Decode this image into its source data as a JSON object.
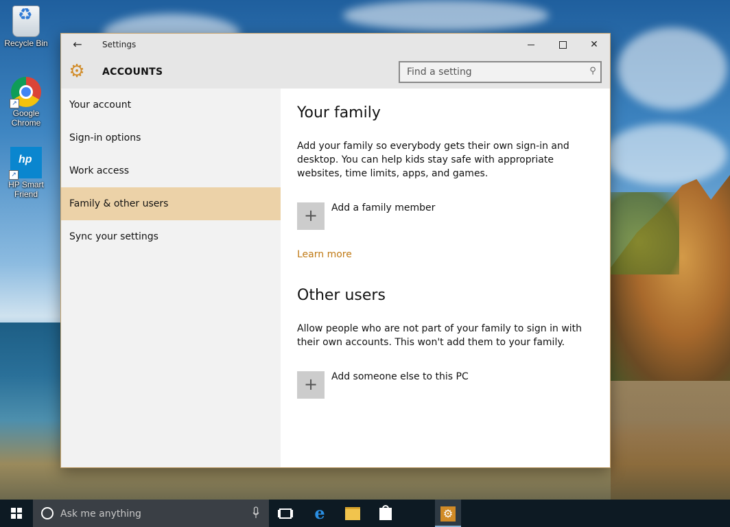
{
  "desktop": {
    "icons": [
      {
        "label": "Recycle Bin"
      },
      {
        "label": "Google Chrome"
      },
      {
        "label": "HP Smart Friend"
      }
    ]
  },
  "window": {
    "title": "Settings",
    "back_glyph": "←",
    "close_glyph": "✕"
  },
  "header": {
    "section_title": "ACCOUNTS",
    "gear_glyph": "⚙",
    "search_placeholder": "Find a setting",
    "search_glyph": "⚲"
  },
  "sidebar": {
    "items": [
      {
        "label": "Your account",
        "active": false
      },
      {
        "label": "Sign-in options",
        "active": false
      },
      {
        "label": "Work access",
        "active": false
      },
      {
        "label": "Family & other users",
        "active": true
      },
      {
        "label": "Sync your settings",
        "active": false
      }
    ]
  },
  "content": {
    "family": {
      "heading": "Your family",
      "description": "Add your family so everybody gets their own sign-in and desktop. You can help kids stay safe with appropriate websites, time limits, apps, and games.",
      "add_label": "Add a family member",
      "learn_more": "Learn more"
    },
    "other_users": {
      "heading": "Other users",
      "description": "Allow people who are not part of your family to sign in with their own accounts. This won't add them to your family.",
      "add_label": "Add someone else to this PC"
    },
    "plus_glyph": "+"
  },
  "taskbar": {
    "search_placeholder": "Ask me anything",
    "mic_glyph": "🎙",
    "edge_glyph": "e",
    "settings_glyph": "⚙"
  },
  "colors": {
    "accent": "#d18b27",
    "active_nav": "#ecd2a8",
    "link": "#c07a15"
  }
}
